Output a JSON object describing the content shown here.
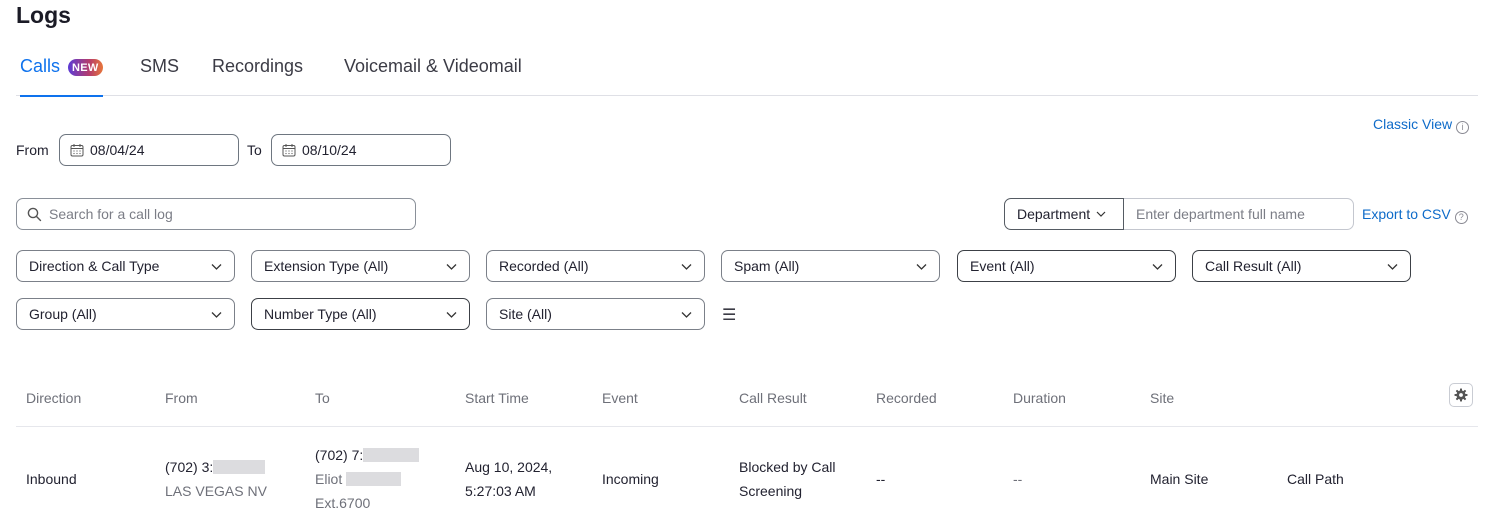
{
  "page": {
    "title": "Logs"
  },
  "tabs": [
    {
      "label": "Calls",
      "badge": "NEW",
      "active": true
    },
    {
      "label": "SMS"
    },
    {
      "label": "Recordings"
    },
    {
      "label": "Voicemail & Videomail"
    }
  ],
  "classic_view": {
    "label": "Classic View",
    "icon": "info-icon"
  },
  "date_range": {
    "from_label": "From",
    "from_value": "08/04/24",
    "to_label": "To",
    "to_value": "08/10/24",
    "icon": "calendar-icon"
  },
  "search": {
    "placeholder": "Search for a call log",
    "icon": "search-icon"
  },
  "department": {
    "select_label": "Department",
    "input_placeholder": "Enter department full name"
  },
  "export": {
    "label": "Export to CSV",
    "icon": "help-icon"
  },
  "filters": [
    {
      "label": "Direction & Call Type"
    },
    {
      "label": "Extension Type (All)"
    },
    {
      "label": "Recorded (All)"
    },
    {
      "label": "Spam (All)"
    },
    {
      "label": "Event (All)"
    },
    {
      "label": "Call Result (All)"
    },
    {
      "label": "Group (All)"
    },
    {
      "label": "Number Type (All)"
    },
    {
      "label": "Site (All)"
    }
  ],
  "filter_menu_icon": "list-menu-icon",
  "table": {
    "columns": [
      "Direction",
      "From",
      "To",
      "Start Time",
      "Event",
      "Call Result",
      "Recorded",
      "Duration",
      "Site"
    ],
    "settings_icon": "gear-icon",
    "rows": [
      {
        "direction": "Inbound",
        "from_number": "(702) 3:",
        "from_location": "LAS VEGAS NV",
        "to_number": "(702) 7:",
        "to_name": "Eliot",
        "to_ext": "Ext.6700",
        "start_date": "Aug 10, 2024,",
        "start_time": "5:27:03 AM",
        "event": "Incoming",
        "result_line1": "Blocked by Call",
        "result_line2": "Screening",
        "recorded": "--",
        "duration": "--",
        "site": "Main Site",
        "action": "Call Path"
      }
    ]
  },
  "colors": {
    "accent": "#0e72ed",
    "link": "#0e6bc9",
    "text": "#222230",
    "muted": "#6e7079"
  }
}
